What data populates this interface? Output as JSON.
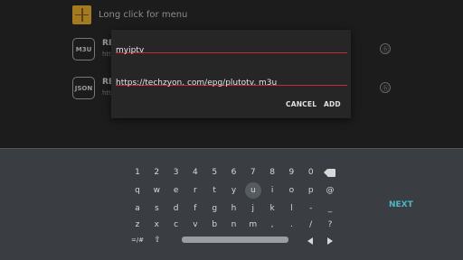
{
  "app": {
    "menu_hint": "Long click for menu",
    "items": [
      {
        "icon_label": "M3U",
        "title": "RE",
        "subtitle": "htt"
      },
      {
        "icon_label": "JSON",
        "title": "RE",
        "subtitle": "htt"
      }
    ]
  },
  "dialog": {
    "name_value": "myiptv",
    "url_value": "https://techzyon. com/epg/plutotv. m3u",
    "cancel_label": "CANCEL",
    "add_label": "ADD"
  },
  "keyboard": {
    "row1": [
      "1",
      "2",
      "3",
      "4",
      "5",
      "6",
      "7",
      "8",
      "9",
      "0"
    ],
    "row2": [
      "q",
      "w",
      "e",
      "r",
      "t",
      "y",
      "u",
      "i",
      "o",
      "p",
      "@"
    ],
    "row3": [
      "a",
      "s",
      "d",
      "f",
      "g",
      "h",
      "j",
      "k",
      "l",
      "-",
      "_"
    ],
    "row4": [
      "z",
      "x",
      "c",
      "v",
      "b",
      "n",
      "m",
      ",",
      ".",
      "/",
      "?"
    ],
    "symbols_label": "=/#",
    "shift_label": "⇧",
    "next_label": "NEXT",
    "active_key": "u"
  },
  "colors": {
    "accent": "#c8283a",
    "next": "#4bb8c5",
    "add_box": "#a37a1f"
  }
}
